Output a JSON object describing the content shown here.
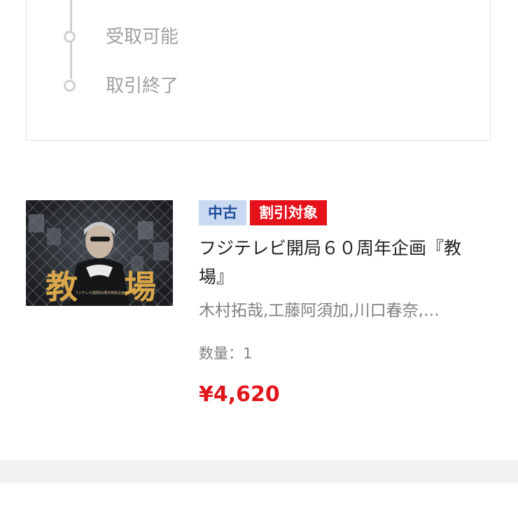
{
  "order_status": {
    "steps": [
      {
        "label": "受取可能"
      },
      {
        "label": "取引終了"
      }
    ]
  },
  "product": {
    "thumbnail": {
      "title_chars": [
        "教",
        "場"
      ],
      "subtitle": "フジテレビ開局60周年特別企画"
    },
    "badges": {
      "condition": "中古",
      "discount": "割引対象"
    },
    "title": "フジテレビ開局６０周年企画『教場』",
    "cast": "木村拓哉,工藤阿須加,川口春奈,…",
    "quantity_text": "数量：1",
    "price": "¥4,620"
  },
  "colors": {
    "badge_condition_bg": "#c9d9f2",
    "badge_condition_text": "#1f4e9a",
    "badge_discount_bg": "#e5111b",
    "price": "#e0161c"
  }
}
